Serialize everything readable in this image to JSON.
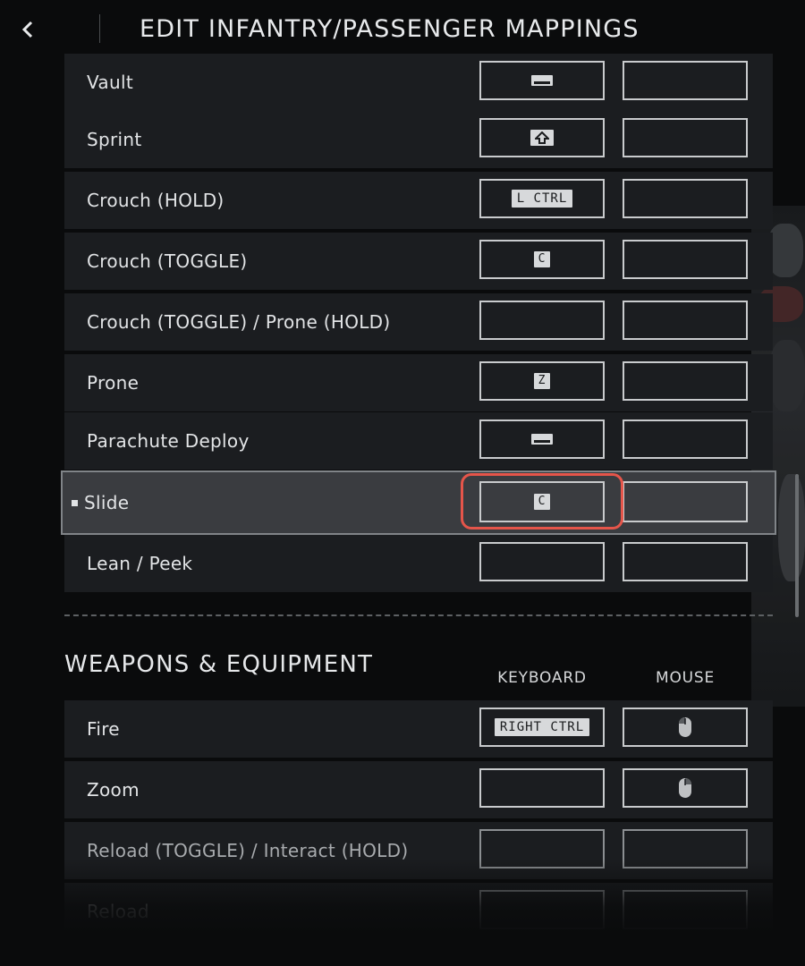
{
  "header": {
    "title": "EDIT INFANTRY/PASSENGER MAPPINGS",
    "back_icon": "chevron-left-icon"
  },
  "movement_rows": [
    {
      "label": "Vault",
      "keyboard": "space-icon",
      "mouse": ""
    },
    {
      "label": "Sprint",
      "keyboard": "shift-icon",
      "mouse": ""
    },
    {
      "label": "Crouch (HOLD)",
      "keyboard": "L CTRL",
      "mouse": ""
    },
    {
      "label": "Crouch (TOGGLE)",
      "keyboard": "C",
      "mouse": ""
    },
    {
      "label": "Crouch (TOGGLE) / Prone (HOLD)",
      "keyboard": "",
      "mouse": ""
    },
    {
      "label": "Prone",
      "keyboard": "Z",
      "mouse": ""
    },
    {
      "label": "Parachute Deploy",
      "keyboard": "space-icon",
      "mouse": ""
    },
    {
      "label": "Slide",
      "keyboard": "C",
      "mouse": "",
      "selected": true
    },
    {
      "label": "Lean / Peek",
      "keyboard": "",
      "mouse": ""
    }
  ],
  "weapons": {
    "section_title": "WEAPONS & EQUIPMENT",
    "col_keyboard": "KEYBOARD",
    "col_mouse": "MOUSE",
    "rows": [
      {
        "label": "Fire",
        "keyboard": "RIGHT CTRL",
        "mouse": "mouse-left-icon"
      },
      {
        "label": "Zoom",
        "keyboard": "",
        "mouse": "mouse-right-icon"
      },
      {
        "label": "Reload (TOGGLE) / Interact (HOLD)",
        "keyboard": "",
        "mouse": ""
      },
      {
        "label": "Reload",
        "keyboard": "",
        "mouse": ""
      }
    ]
  },
  "colors": {
    "highlight": "#e5554a",
    "row_bg": "#1b1d20",
    "selected_bg": "#3a3c40"
  }
}
